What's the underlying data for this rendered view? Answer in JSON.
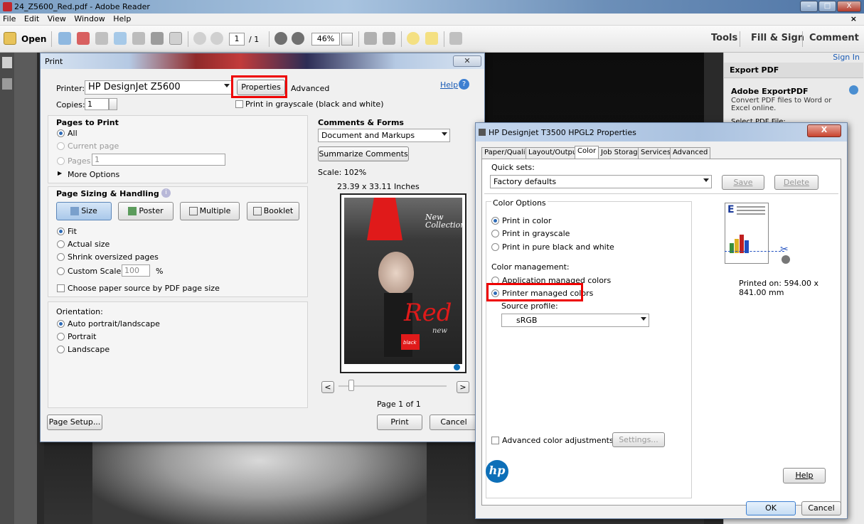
{
  "window": {
    "title": "24_Z5600_Red.pdf - Adobe Reader",
    "controls": {
      "minimize": "–",
      "maximize": "□",
      "close": "X"
    }
  },
  "menubar": {
    "items": [
      "File",
      "Edit",
      "View",
      "Window",
      "Help"
    ],
    "close_x": "×"
  },
  "toolbar": {
    "open_label": "Open",
    "page_current": "1",
    "page_total": "/ 1",
    "zoom": "46%",
    "tools": "Tools",
    "fill_sign": "Fill & Sign",
    "comment": "Comment"
  },
  "right_panel": {
    "sign_in": "Sign In",
    "export_pdf": "Export PDF",
    "adobe_export": "Adobe ExportPDF",
    "desc": "Convert PDF files to Word or Excel online.",
    "select_file": "Select PDF File:"
  },
  "print_dialog": {
    "title": "Print",
    "printer_label": "Printer:",
    "printer_value": "HP DesignJet Z5600",
    "properties": "Properties",
    "advanced": "Advanced",
    "help": "Help",
    "copies_label": "Copies:",
    "copies_value": "1",
    "grayscale": "Print in grayscale (black and white)",
    "pages_to_print": "Pages to Print",
    "all": "All",
    "current_page": "Current page",
    "pages": "Pages",
    "pages_value": "1",
    "more_options": "More Options",
    "page_sizing": "Page Sizing & Handling",
    "size": "Size",
    "poster": "Poster",
    "multiple": "Multiple",
    "booklet": "Booklet",
    "fit": "Fit",
    "actual_size": "Actual size",
    "shrink": "Shrink oversized pages",
    "custom_scale": "Custom Scale:",
    "custom_scale_value": "100",
    "percent": "%",
    "choose_paper": "Choose paper source by PDF page size",
    "orientation": "Orientation:",
    "auto": "Auto portrait/landscape",
    "portrait": "Portrait",
    "landscape": "Landscape",
    "comments_forms": "Comments & Forms",
    "comments_value": "Document and Markups",
    "summarize": "Summarize Comments",
    "scale": "Scale: 102%",
    "dims": "23.39 x 33.11 Inches",
    "page_of": "Page 1 of 1",
    "prev": "<",
    "next": ">",
    "page_setup": "Page Setup...",
    "print": "Print",
    "cancel": "Cancel",
    "poster_text": {
      "new_collection": "New Collection",
      "red": "Red",
      "new": "new",
      "black": "black"
    }
  },
  "props_dialog": {
    "title": "HP Designjet T3500 HPGL2 Properties",
    "tabs": [
      "Paper/Quality",
      "Layout/Output",
      "Color",
      "Job Storage",
      "Services",
      "Advanced"
    ],
    "active_tab": "Color",
    "quick_sets": "Quick sets:",
    "quick_value": "Factory defaults",
    "save": "Save",
    "delete": "Delete",
    "color_options": "Color Options",
    "print_in_color": "Print in color",
    "print_grayscale": "Print in grayscale",
    "print_bw": "Print in pure black and white",
    "color_mgmt": "Color management:",
    "app_managed": "Application managed colors",
    "printer_managed": "Printer managed colors",
    "source_profile": "Source profile:",
    "source_value": "sRGB",
    "printed_on": "Printed on: 594.00 x 841.00 mm",
    "advanced_adj": "Advanced color adjustments",
    "settings": "Settings...",
    "help": "Help",
    "ok": "OK",
    "cancel": "Cancel",
    "close": "X",
    "hp": "hp",
    "e_letter": "E"
  },
  "colors": {
    "accent_blue": "#2e6bb7",
    "highlight_red": "#e00000",
    "poster_red": "#e01a1a"
  }
}
